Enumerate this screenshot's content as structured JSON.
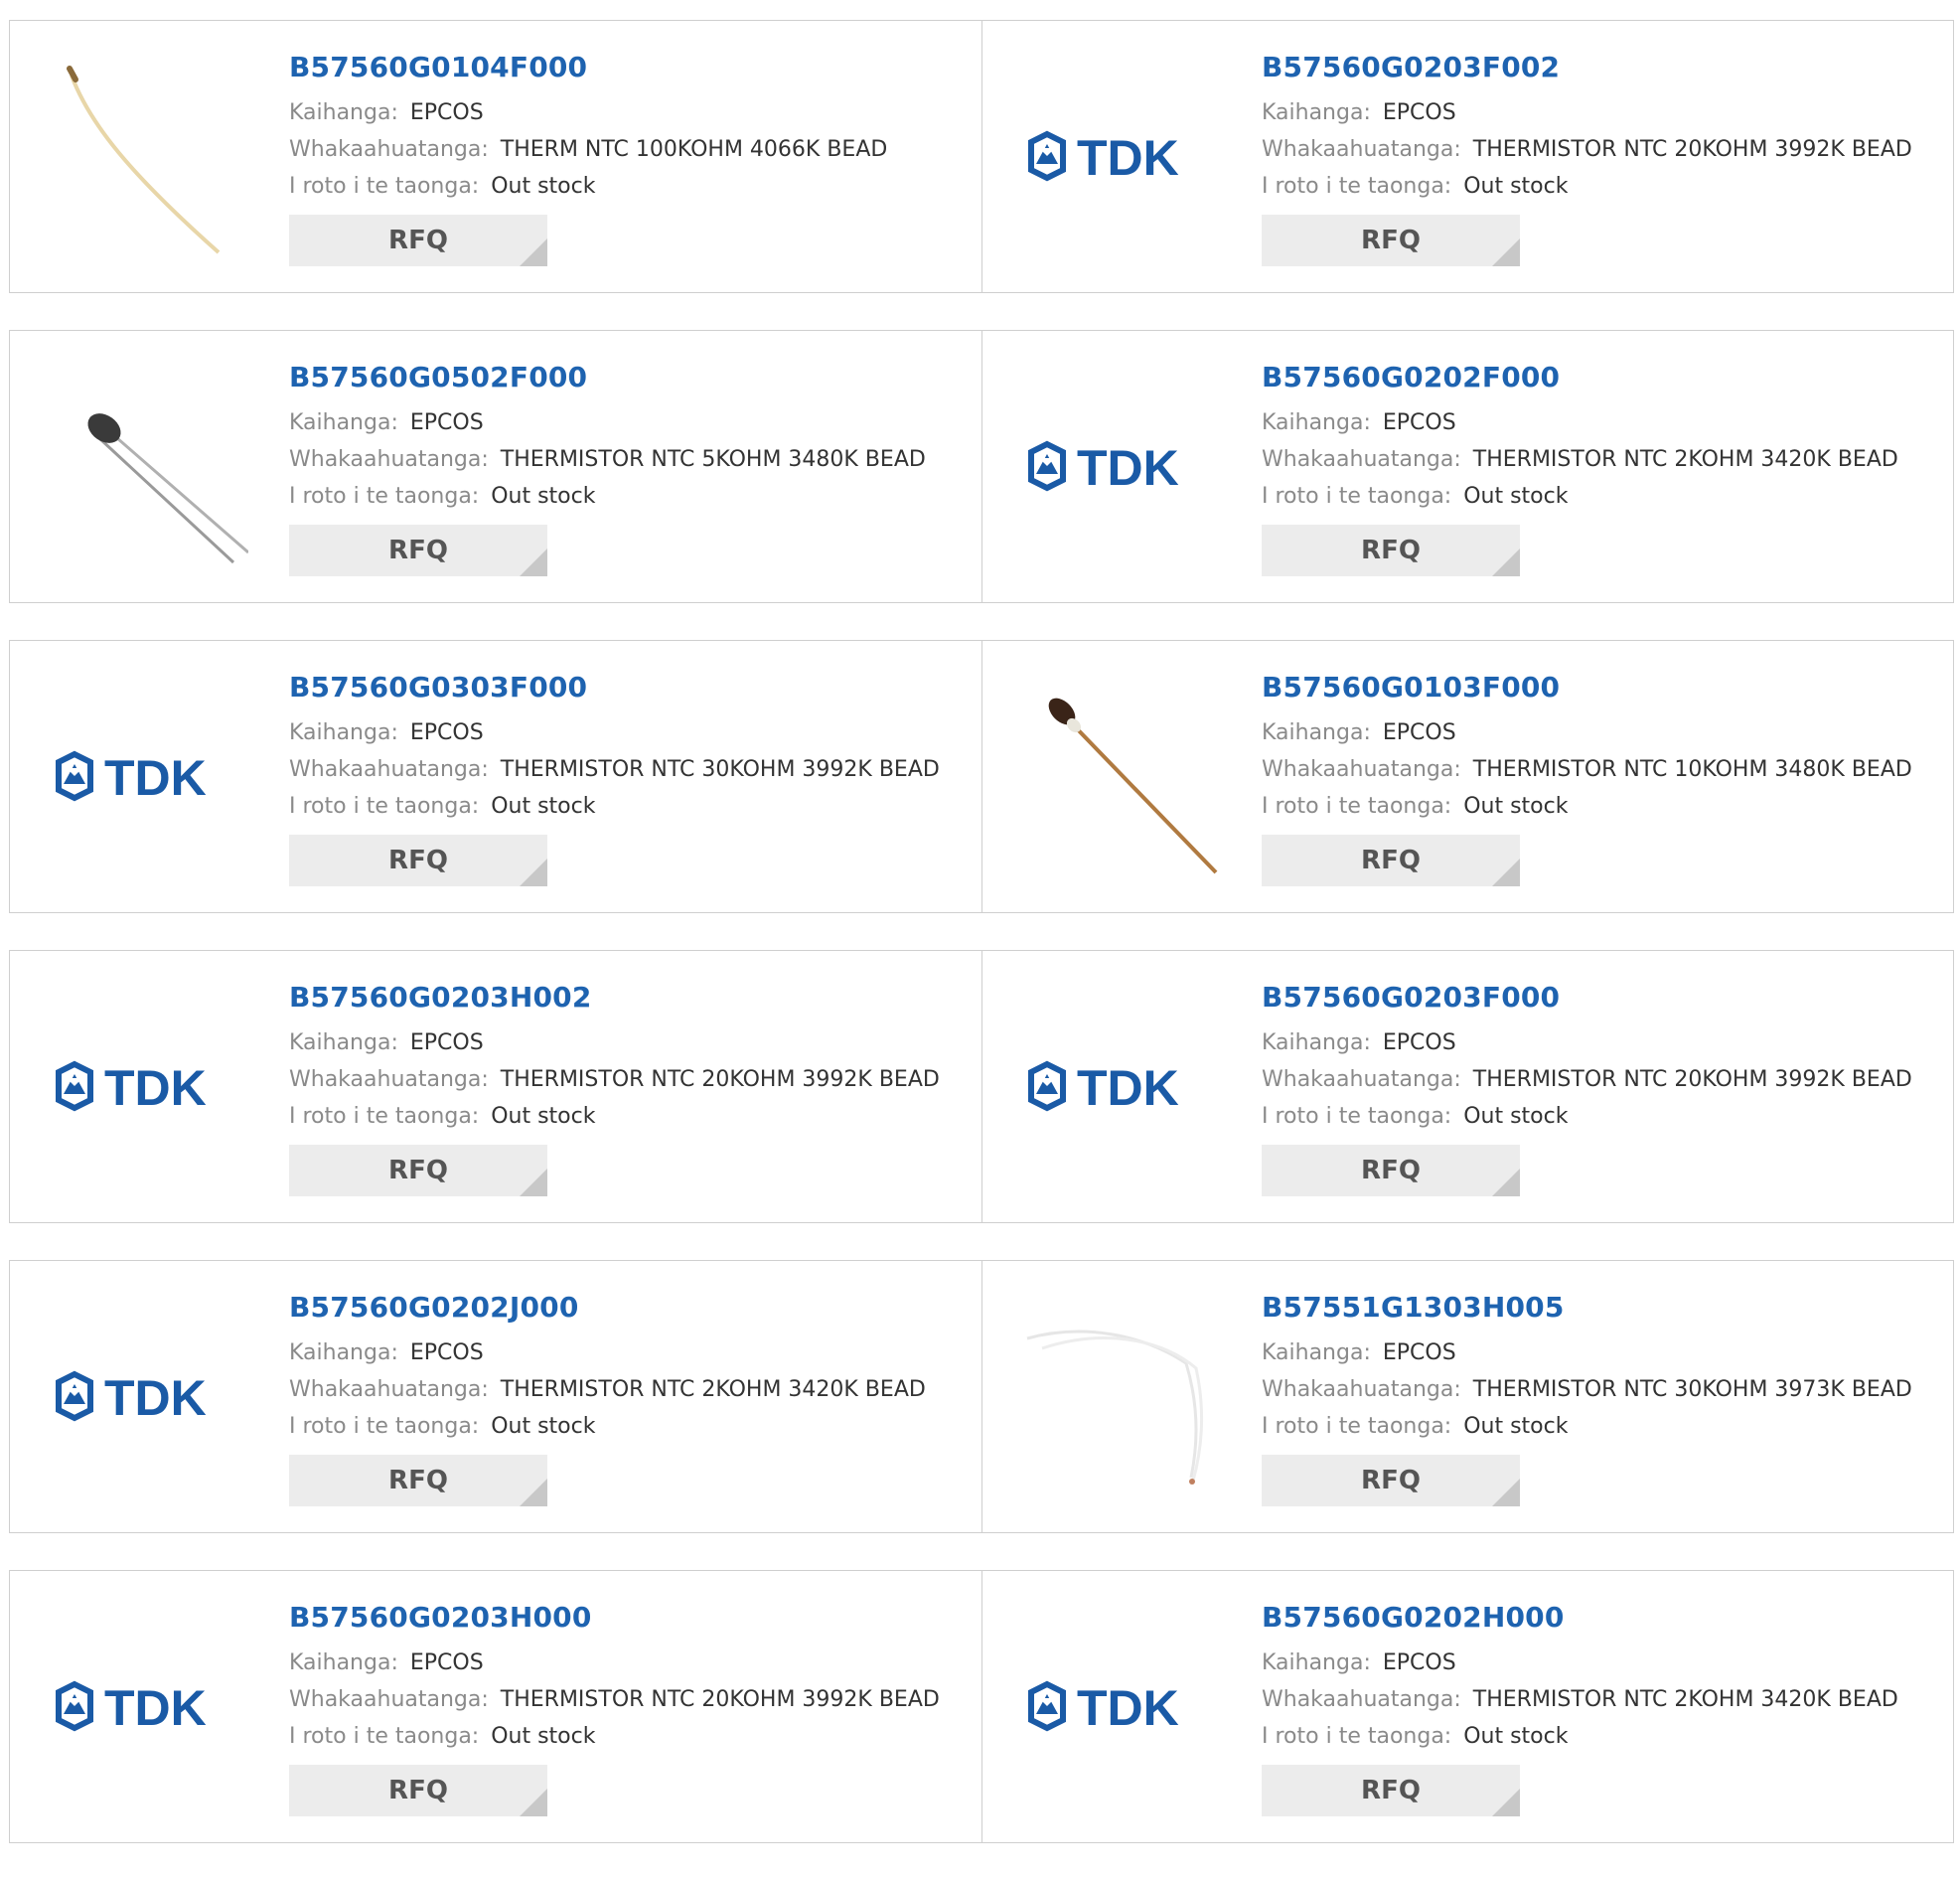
{
  "labels": {
    "manufacturer": "Kaihanga:",
    "description": "Whakaahuatanga:",
    "stock": "I roto i te taonga:",
    "rfq": "RFQ"
  },
  "colors": {
    "link": "#1e63b0",
    "tdk_logo": "#1a5aa6",
    "button_bg": "#ececec"
  },
  "logo_text": "TDK",
  "products": [
    {
      "part": "B57560G0104F000",
      "manufacturer": "EPCOS",
      "description": "THERM NTC 100KOHM 4066K BEAD",
      "stock": "Out stock",
      "image": "thermistor-tan-lead"
    },
    {
      "part": "B57560G0203F002",
      "manufacturer": "EPCOS",
      "description": "THERMISTOR NTC 20KOHM 3992K BEAD",
      "stock": "Out stock",
      "image": "tdk-logo"
    },
    {
      "part": "B57560G0502F000",
      "manufacturer": "EPCOS",
      "description": "THERMISTOR NTC 5KOHM 3480K BEAD",
      "stock": "Out stock",
      "image": "thermistor-dark-bead"
    },
    {
      "part": "B57560G0202F000",
      "manufacturer": "EPCOS",
      "description": "THERMISTOR NTC 2KOHM 3420K BEAD",
      "stock": "Out stock",
      "image": "tdk-logo"
    },
    {
      "part": "B57560G0303F000",
      "manufacturer": "EPCOS",
      "description": "THERMISTOR NTC 30KOHM 3992K BEAD",
      "stock": "Out stock",
      "image": "tdk-logo"
    },
    {
      "part": "B57560G0103F000",
      "manufacturer": "EPCOS",
      "description": "THERMISTOR NTC 10KOHM 3480K BEAD",
      "stock": "Out stock",
      "image": "thermistor-brown-bead"
    },
    {
      "part": "B57560G0203H002",
      "manufacturer": "EPCOS",
      "description": "THERMISTOR NTC 20KOHM 3992K BEAD",
      "stock": "Out stock",
      "image": "tdk-logo"
    },
    {
      "part": "B57560G0203F000",
      "manufacturer": "EPCOS",
      "description": "THERMISTOR NTC 20KOHM 3992K BEAD",
      "stock": "Out stock",
      "image": "tdk-logo"
    },
    {
      "part": "B57560G0202J000",
      "manufacturer": "EPCOS",
      "description": "THERMISTOR NTC 2KOHM 3420K BEAD",
      "stock": "Out stock",
      "image": "tdk-logo"
    },
    {
      "part": "B57551G1303H005",
      "manufacturer": "EPCOS",
      "description": "THERMISTOR NTC 30KOHM 3973K BEAD",
      "stock": "Out stock",
      "image": "thermistor-white-wire"
    },
    {
      "part": "B57560G0203H000",
      "manufacturer": "EPCOS",
      "description": "THERMISTOR NTC 20KOHM 3992K BEAD",
      "stock": "Out stock",
      "image": "tdk-logo"
    },
    {
      "part": "B57560G0202H000",
      "manufacturer": "EPCOS",
      "description": "THERMISTOR NTC 2KOHM 3420K BEAD",
      "stock": "Out stock",
      "image": "tdk-logo"
    }
  ]
}
